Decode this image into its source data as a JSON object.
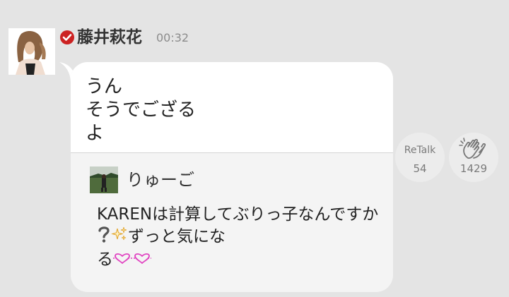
{
  "post": {
    "username": "藤井萩花",
    "time": "00:32",
    "message": "うん\nそうでござる\nよ"
  },
  "quote": {
    "username": "りゅーご",
    "text_part1": "KARENは計算してぶりっ子なんですか",
    "text_part2": "ずっと気にな",
    "text_part3": "る"
  },
  "actions": {
    "retalk_label": "ReTalk",
    "retalk_count": "54",
    "clap_count": "1429"
  },
  "icons": {
    "verified": "verified-check-icon",
    "clap": "clap-hands-icon",
    "question": "question-mark-icon",
    "sparkle": "sparkle-icon",
    "hearts": "pink-hearts-icon"
  },
  "colors": {
    "verified_red": "#cc2222",
    "background": "#e4e4e4"
  }
}
